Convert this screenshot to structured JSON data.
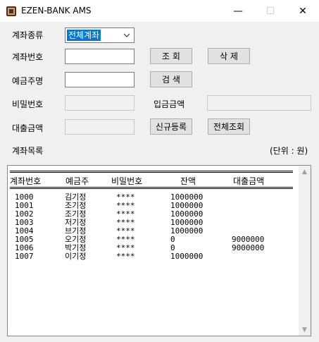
{
  "window": {
    "title": "EZEN-BANK AMS",
    "minimize_glyph": "—",
    "maximize_glyph": "☐",
    "close_glyph": "✕"
  },
  "form": {
    "account_type_label": "계좌종류",
    "account_type_value": "전체계좌",
    "account_no_label": "계좌번호",
    "account_no_value": "",
    "owner_label": "예금주명",
    "owner_value": "",
    "password_label": "비밀번호",
    "password_value": "",
    "deposit_label": "입금금액",
    "deposit_value": "",
    "loan_label": "대출금액",
    "loan_value": "",
    "account_list_label": "계좌목록",
    "unit_label": "(단위 : 원)"
  },
  "buttons": {
    "lookup": "조 회",
    "delete": "삭 제",
    "search": "검 색",
    "register": "신규등록",
    "lookup_all": "전체조회"
  },
  "list": {
    "headers": [
      "계좌번호",
      "예금주",
      "비밀번호",
      "잔액",
      "대출금액"
    ],
    "rows": [
      [
        "1000",
        "김기정",
        "****",
        "1000000",
        ""
      ],
      [
        "1001",
        "조기정",
        "****",
        "1000000",
        ""
      ],
      [
        "1002",
        "조기정",
        "****",
        "1000000",
        ""
      ],
      [
        "1003",
        "저기정",
        "****",
        "1000000",
        ""
      ],
      [
        "1004",
        "브기정",
        "****",
        "1000000",
        ""
      ],
      [
        "1005",
        "오기정",
        "****",
        "0",
        "9000000"
      ],
      [
        "1006",
        "박기정",
        "****",
        "0",
        "9000000"
      ],
      [
        "1007",
        "이기정",
        "****",
        "1000000",
        ""
      ]
    ]
  },
  "colors": {
    "selection": "#0078d7",
    "window_bg": "#f0f0f0"
  }
}
